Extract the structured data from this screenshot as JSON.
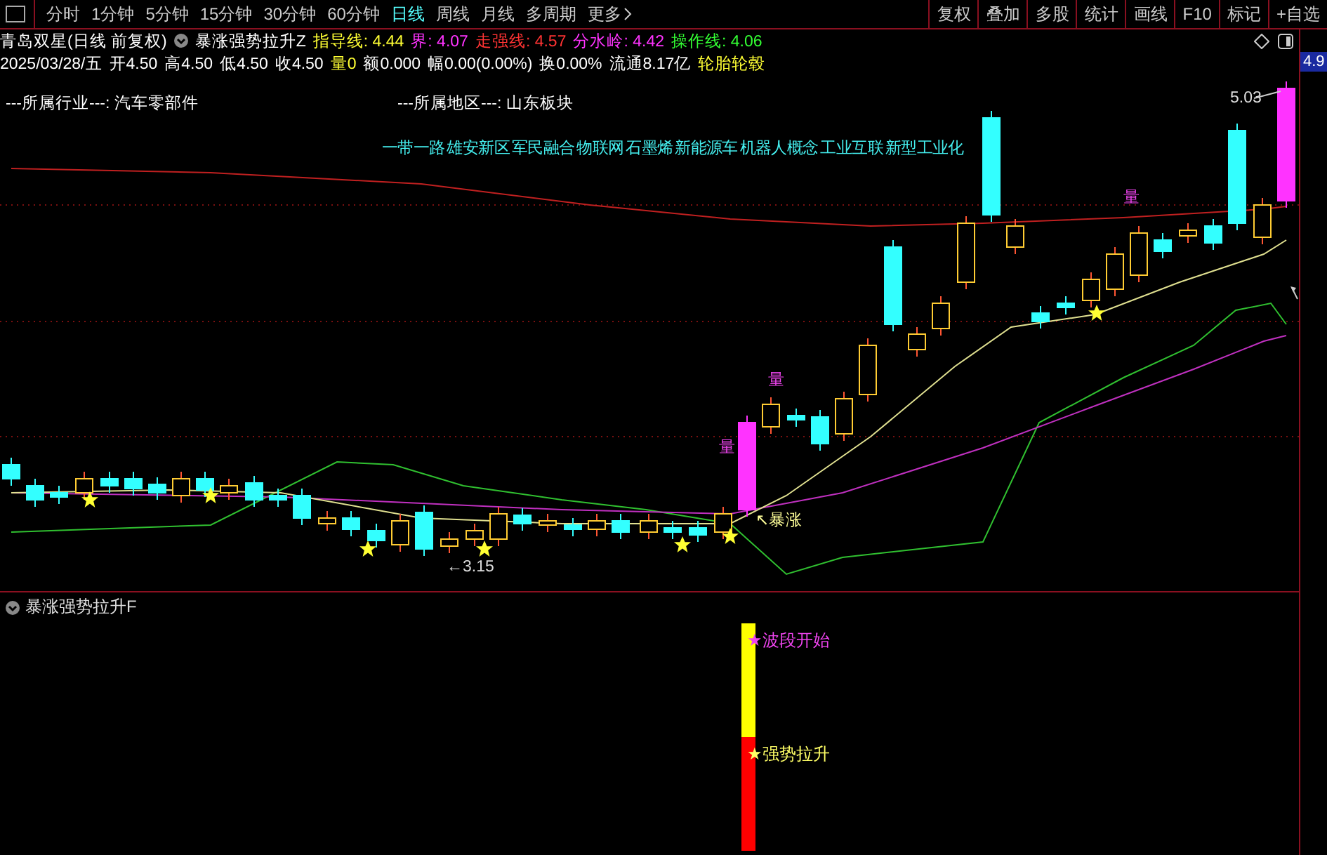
{
  "toolbar": {
    "periods": [
      {
        "label": "分时",
        "selected": false
      },
      {
        "label": "1分钟",
        "selected": false
      },
      {
        "label": "5分钟",
        "selected": false
      },
      {
        "label": "15分钟",
        "selected": false
      },
      {
        "label": "30分钟",
        "selected": false
      },
      {
        "label": "60分钟",
        "selected": false
      },
      {
        "label": "日线",
        "selected": true
      },
      {
        "label": "周线",
        "selected": false
      },
      {
        "label": "月线",
        "selected": false
      },
      {
        "label": "多周期",
        "selected": false
      },
      {
        "label": "更多",
        "selected": false
      }
    ],
    "actions": [
      "复权",
      "叠加",
      "多股",
      "统计",
      "画线",
      "F10",
      "标记",
      "+自选"
    ]
  },
  "header": {
    "title": "青岛双星(日线 前复权)",
    "indicator": "暴涨强势拉升Z",
    "values": [
      {
        "text": "指导线: 4.44",
        "color": "#ffff33"
      },
      {
        "text": "界: 4.07",
        "color": "#ff33ff"
      },
      {
        "text": "走强线: 4.57",
        "color": "#ff3333"
      },
      {
        "text": "分水岭: 4.42",
        "color": "#ff33ff"
      },
      {
        "text": "操作线: 4.06",
        "color": "#33ff33"
      }
    ]
  },
  "quote": [
    {
      "text": "2025/03/28/五",
      "color": "#ffffff"
    },
    {
      "text": "开4.50",
      "color": "#ffffff"
    },
    {
      "text": "高4.50",
      "color": "#ffffff"
    },
    {
      "text": "低4.50",
      "color": "#ffffff"
    },
    {
      "text": "收4.50",
      "color": "#ffffff"
    },
    {
      "text": "量0",
      "color": "#ffff33"
    },
    {
      "text": "额0.000",
      "color": "#ffffff"
    },
    {
      "text": "幅0.00(0.00%)",
      "color": "#ffffff"
    },
    {
      "text": "换0.00%",
      "color": "#ffffff"
    },
    {
      "text": "流通8.17亿",
      "color": "#ffffff"
    },
    {
      "text": "轮胎轮毂",
      "color": "#ffff33"
    }
  ],
  "chart": {
    "industry": "---所属行业---: 汽车零部件",
    "region": "---所属地区---: 山东板块",
    "concepts": "一带一路 雄安新区 军民融合 物联网 石墨烯 新能源车 机器人概念 工业互联 新型工业化",
    "annotations": [
      {
        "kind": "volume",
        "text": "量"
      },
      {
        "kind": "volume",
        "text": "量"
      },
      {
        "kind": "volume",
        "text": "量"
      },
      {
        "kind": "signal",
        "text": "↖暴涨"
      },
      {
        "kind": "low",
        "text": "←3.15"
      },
      {
        "kind": "high",
        "text": "5.03"
      }
    ],
    "price_tag": "4.9"
  },
  "indicator_panel": {
    "title": "暴涨强势拉升F",
    "signals": [
      {
        "kind": "wave_start",
        "text": "★波段开始",
        "color": "#ee44ee"
      },
      {
        "kind": "strong_rise",
        "text": "★强势拉升",
        "color": "#ffff66"
      }
    ]
  }
}
